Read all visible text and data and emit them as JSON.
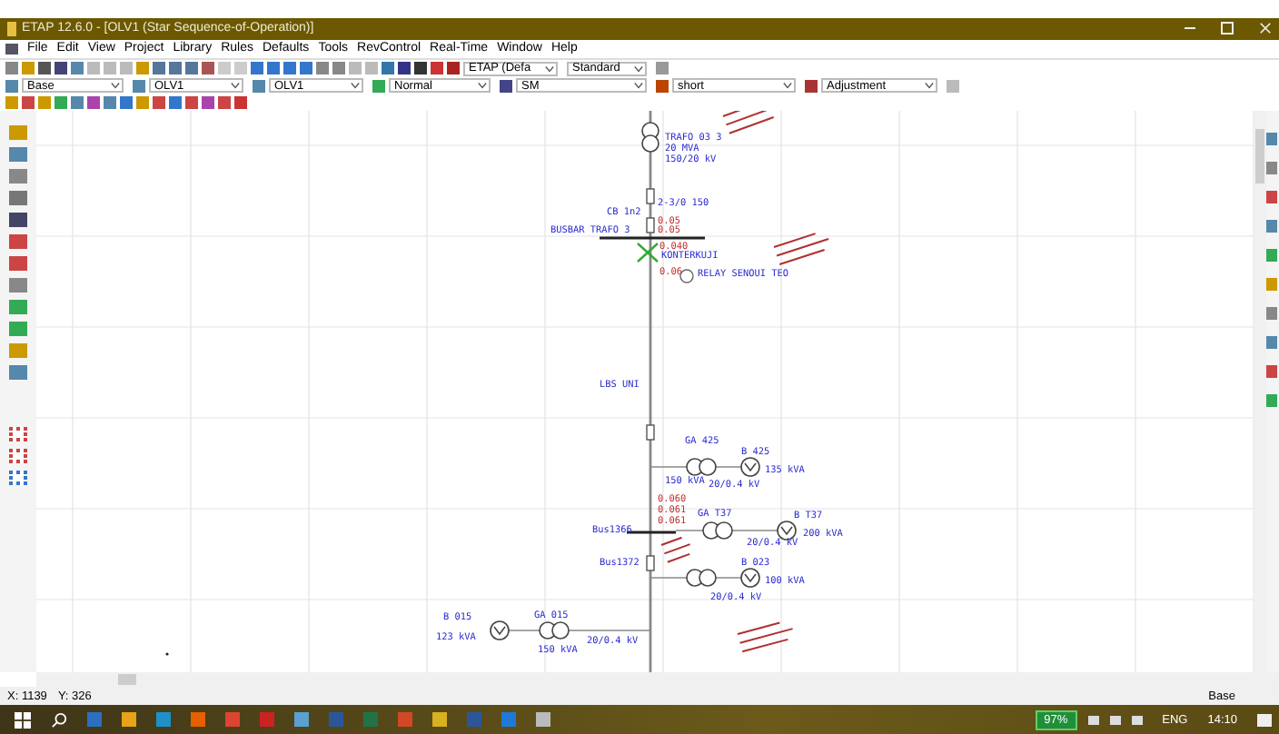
{
  "window": {
    "title": "ETAP 12.6.0 - [OLV1 (Star Sequence-of-Operation)]"
  },
  "menu": [
    "File",
    "Edit",
    "View",
    "Project",
    "Library",
    "Rules",
    "Defaults",
    "Tools",
    "RevControl",
    "Real-Time",
    "Window",
    "Help"
  ],
  "toolbar": {
    "dropdowns": [
      {
        "value": "ETAP (Defa"
      },
      {
        "value": "Standard"
      },
      {
        "value": "Base"
      },
      {
        "value": "OLV1"
      },
      {
        "value": "OLV1"
      },
      {
        "value": "Normal"
      },
      {
        "value": "SM"
      },
      {
        "value": "short"
      },
      {
        "value": "Adjustment"
      }
    ]
  },
  "diagram": {
    "labels": [
      {
        "text": "TRAFO 03 3",
        "kind": "name"
      },
      {
        "text": "20 MVA",
        "kind": "name"
      },
      {
        "text": "150/20 kV",
        "kind": "name"
      },
      {
        "text": "2-3/0 150",
        "kind": "name"
      },
      {
        "text": "CB 1n2",
        "kind": "name"
      },
      {
        "text": "0.05",
        "kind": "value"
      },
      {
        "text": "0.05",
        "kind": "value"
      },
      {
        "text": "BUSBAR TRAFO 3",
        "kind": "name"
      },
      {
        "text": "0.040",
        "kind": "value"
      },
      {
        "text": "KONTERKUJI",
        "kind": "name"
      },
      {
        "text": "0.06",
        "kind": "value"
      },
      {
        "text": "RELAY SENOUI TEO",
        "kind": "name"
      },
      {
        "text": "LBS UNI",
        "kind": "name"
      },
      {
        "text": "GA 425",
        "kind": "name"
      },
      {
        "text": "B 425",
        "kind": "name"
      },
      {
        "text": "135 kVA",
        "kind": "name"
      },
      {
        "text": "150 kVA",
        "kind": "name"
      },
      {
        "text": "20/0.4 kV",
        "kind": "name"
      },
      {
        "text": "0.060",
        "kind": "value"
      },
      {
        "text": "0.061",
        "kind": "value"
      },
      {
        "text": "0.061",
        "kind": "value"
      },
      {
        "text": "GA T37",
        "kind": "name"
      },
      {
        "text": "B T37",
        "kind": "name"
      },
      {
        "text": "200 kVA",
        "kind": "name"
      },
      {
        "text": "Bus1366",
        "kind": "name"
      },
      {
        "text": "20/0.4 kV",
        "kind": "name"
      },
      {
        "text": "Bus1372",
        "kind": "name"
      },
      {
        "text": "B 023",
        "kind": "name"
      },
      {
        "text": "100 kVA",
        "kind": "name"
      },
      {
        "text": "20/0.4 kV",
        "kind": "name"
      },
      {
        "text": "GA 015",
        "kind": "name"
      },
      {
        "text": "B 015",
        "kind": "name"
      },
      {
        "text": "123 kVA",
        "kind": "name"
      },
      {
        "text": "150 kVA",
        "kind": "name"
      },
      {
        "text": "20/0.4 kV",
        "kind": "name"
      }
    ]
  },
  "status_bar": {
    "x": "X: 1139",
    "y": "Y: 326",
    "mode": "Base"
  },
  "taskbar": {
    "battery": "97%",
    "language": "ENG",
    "clock": "14:10"
  }
}
